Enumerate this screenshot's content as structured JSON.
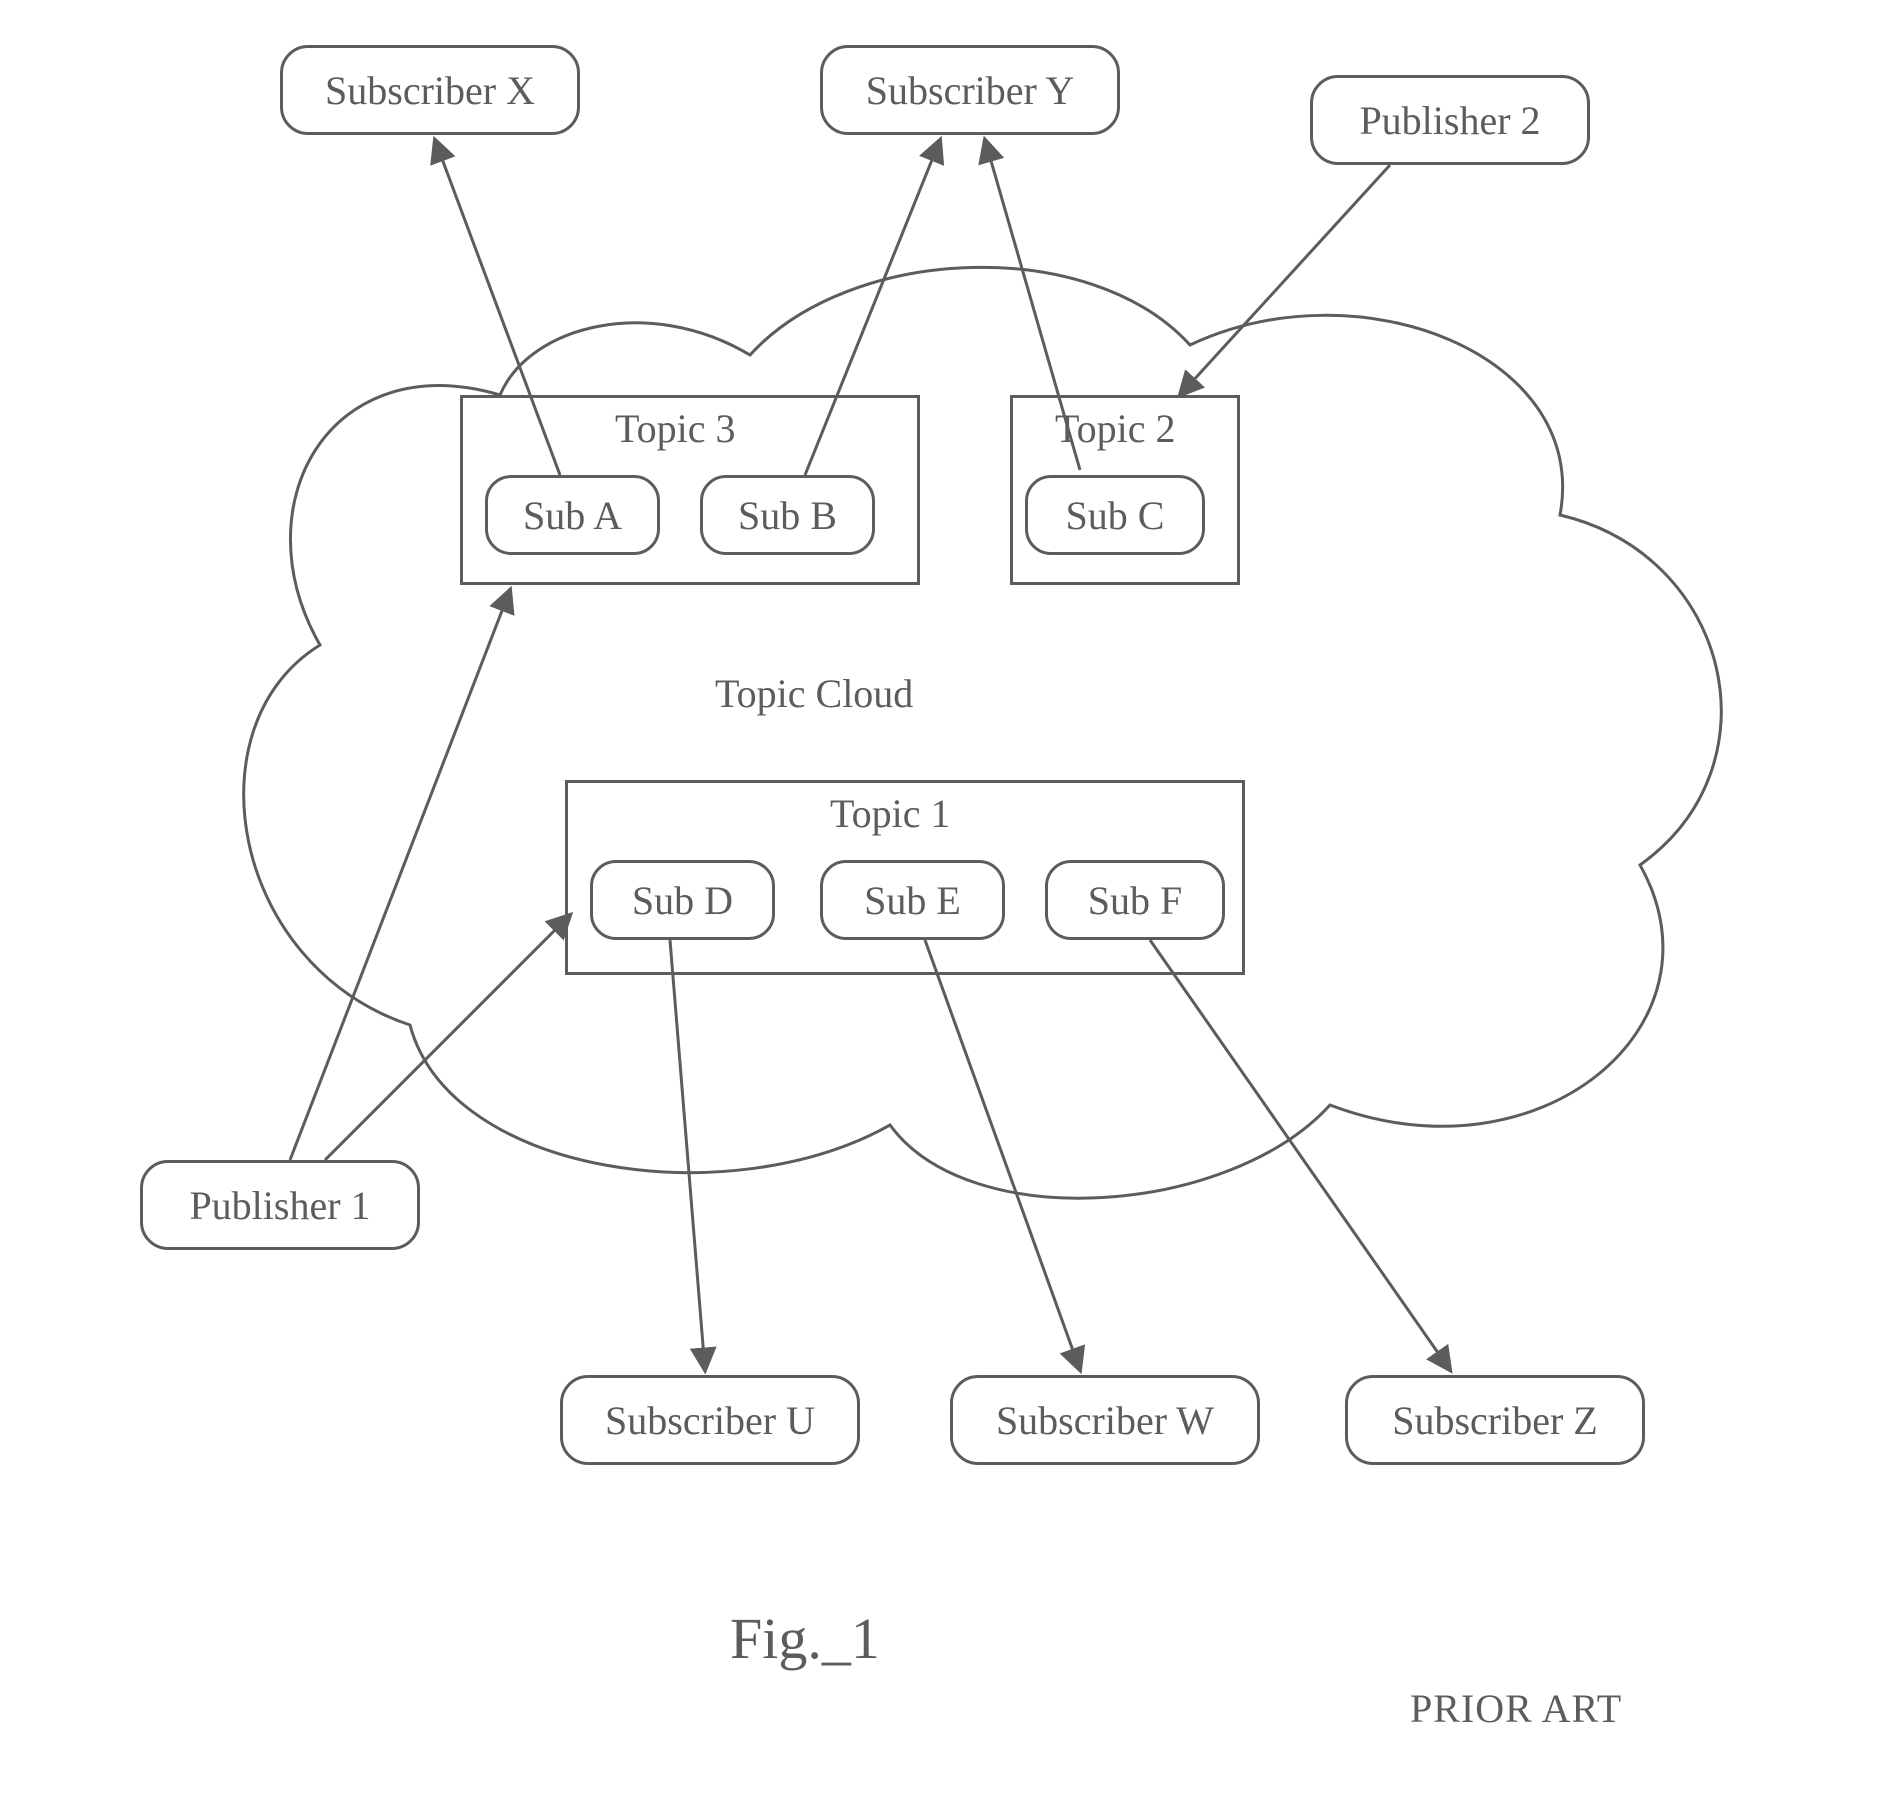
{
  "external_nodes": {
    "subscriber_x": "Subscriber X",
    "subscriber_y": "Subscriber Y",
    "publisher_2": "Publisher 2",
    "publisher_1": "Publisher 1",
    "subscriber_u": "Subscriber U",
    "subscriber_w": "Subscriber W",
    "subscriber_z": "Subscriber Z"
  },
  "cloud": {
    "label": "Topic Cloud"
  },
  "topics": {
    "topic3": {
      "label": "Topic 3",
      "subs": {
        "a": "Sub A",
        "b": "Sub B"
      }
    },
    "topic2": {
      "label": "Topic 2",
      "subs": {
        "c": "Sub C"
      }
    },
    "topic1": {
      "label": "Topic 1",
      "subs": {
        "d": "Sub D",
        "e": "Sub E",
        "f": "Sub F"
      }
    }
  },
  "figure": {
    "caption": "Fig._1",
    "note": "PRIOR ART"
  },
  "arrows": [
    {
      "name": "pub1-to-topic3",
      "from": "publisher_1",
      "to": "topic3"
    },
    {
      "name": "pub1-to-topic1",
      "from": "publisher_1",
      "to": "topic1"
    },
    {
      "name": "pub2-to-topic2",
      "from": "publisher_2",
      "to": "topic2"
    },
    {
      "name": "suba-to-subx",
      "from": "sub_a",
      "to": "subscriber_x"
    },
    {
      "name": "subb-to-suby",
      "from": "sub_b",
      "to": "subscriber_y"
    },
    {
      "name": "subc-to-suby",
      "from": "sub_c",
      "to": "subscriber_y"
    },
    {
      "name": "subd-to-subu",
      "from": "sub_d",
      "to": "subscriber_u"
    },
    {
      "name": "sube-to-subw",
      "from": "sub_e",
      "to": "subscriber_w"
    },
    {
      "name": "subf-to-subz",
      "from": "sub_f",
      "to": "subscriber_z"
    }
  ]
}
